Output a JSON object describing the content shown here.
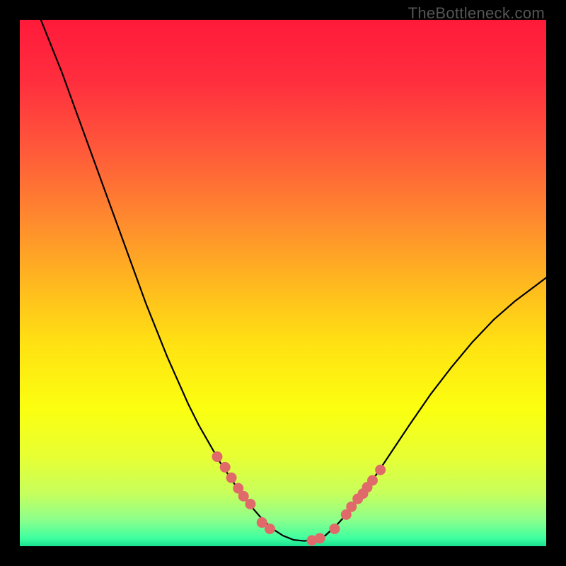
{
  "watermark": "TheBottleneck.com",
  "chart_data": {
    "type": "line",
    "title": "",
    "xlabel": "",
    "ylabel": "",
    "xlim": [
      0,
      100
    ],
    "ylim": [
      0,
      100
    ],
    "grid": false,
    "series": [
      {
        "name": "curve",
        "x": [
          4,
          6,
          8,
          10,
          12,
          14,
          16,
          18,
          20,
          22,
          24,
          26,
          28,
          30,
          32,
          34,
          36,
          38,
          40,
          42,
          44,
          46,
          48,
          50,
          52,
          54,
          56,
          58,
          60,
          62,
          64,
          66,
          68,
          70,
          74,
          78,
          82,
          86,
          90,
          94,
          98,
          100
        ],
        "y": [
          100,
          95,
          90,
          84.5,
          79,
          73.5,
          68,
          62.5,
          57,
          51.5,
          46,
          41,
          36,
          31.5,
          27,
          23,
          19.5,
          16,
          13,
          10,
          7.5,
          5.2,
          3.3,
          2.0,
          1.2,
          1.0,
          1.2,
          2.0,
          3.8,
          6.0,
          8.5,
          11.2,
          14.0,
          17.0,
          23.0,
          28.8,
          34.0,
          38.8,
          43.0,
          46.5,
          49.5,
          51.0
        ]
      }
    ],
    "markers": {
      "name": "highlight-dots",
      "color": "#e06a6a",
      "x": [
        37.5,
        39.0,
        40.2,
        41.5,
        42.5,
        43.8,
        46.0,
        47.5,
        55.5,
        57.0,
        59.8,
        62.0,
        63.0,
        64.2,
        65.2,
        66.0,
        67.0,
        68.5
      ],
      "y": [
        17.0,
        15.0,
        13.0,
        11.0,
        9.5,
        8.0,
        4.5,
        3.3,
        1.1,
        1.5,
        3.3,
        6.0,
        7.5,
        9.0,
        10.0,
        11.2,
        12.5,
        14.5
      ]
    },
    "gradient_stops": [
      {
        "pos": 0.0,
        "color": "#ff1a3a"
      },
      {
        "pos": 0.12,
        "color": "#ff2f3e"
      },
      {
        "pos": 0.25,
        "color": "#ff5a3a"
      },
      {
        "pos": 0.38,
        "color": "#ff8a2e"
      },
      {
        "pos": 0.5,
        "color": "#ffb81f"
      },
      {
        "pos": 0.62,
        "color": "#ffe312"
      },
      {
        "pos": 0.74,
        "color": "#fbff10"
      },
      {
        "pos": 0.83,
        "color": "#e7ff33"
      },
      {
        "pos": 0.9,
        "color": "#c7ff5c"
      },
      {
        "pos": 0.95,
        "color": "#8cff8c"
      },
      {
        "pos": 0.985,
        "color": "#3effa0"
      },
      {
        "pos": 1.0,
        "color": "#18e090"
      }
    ]
  }
}
